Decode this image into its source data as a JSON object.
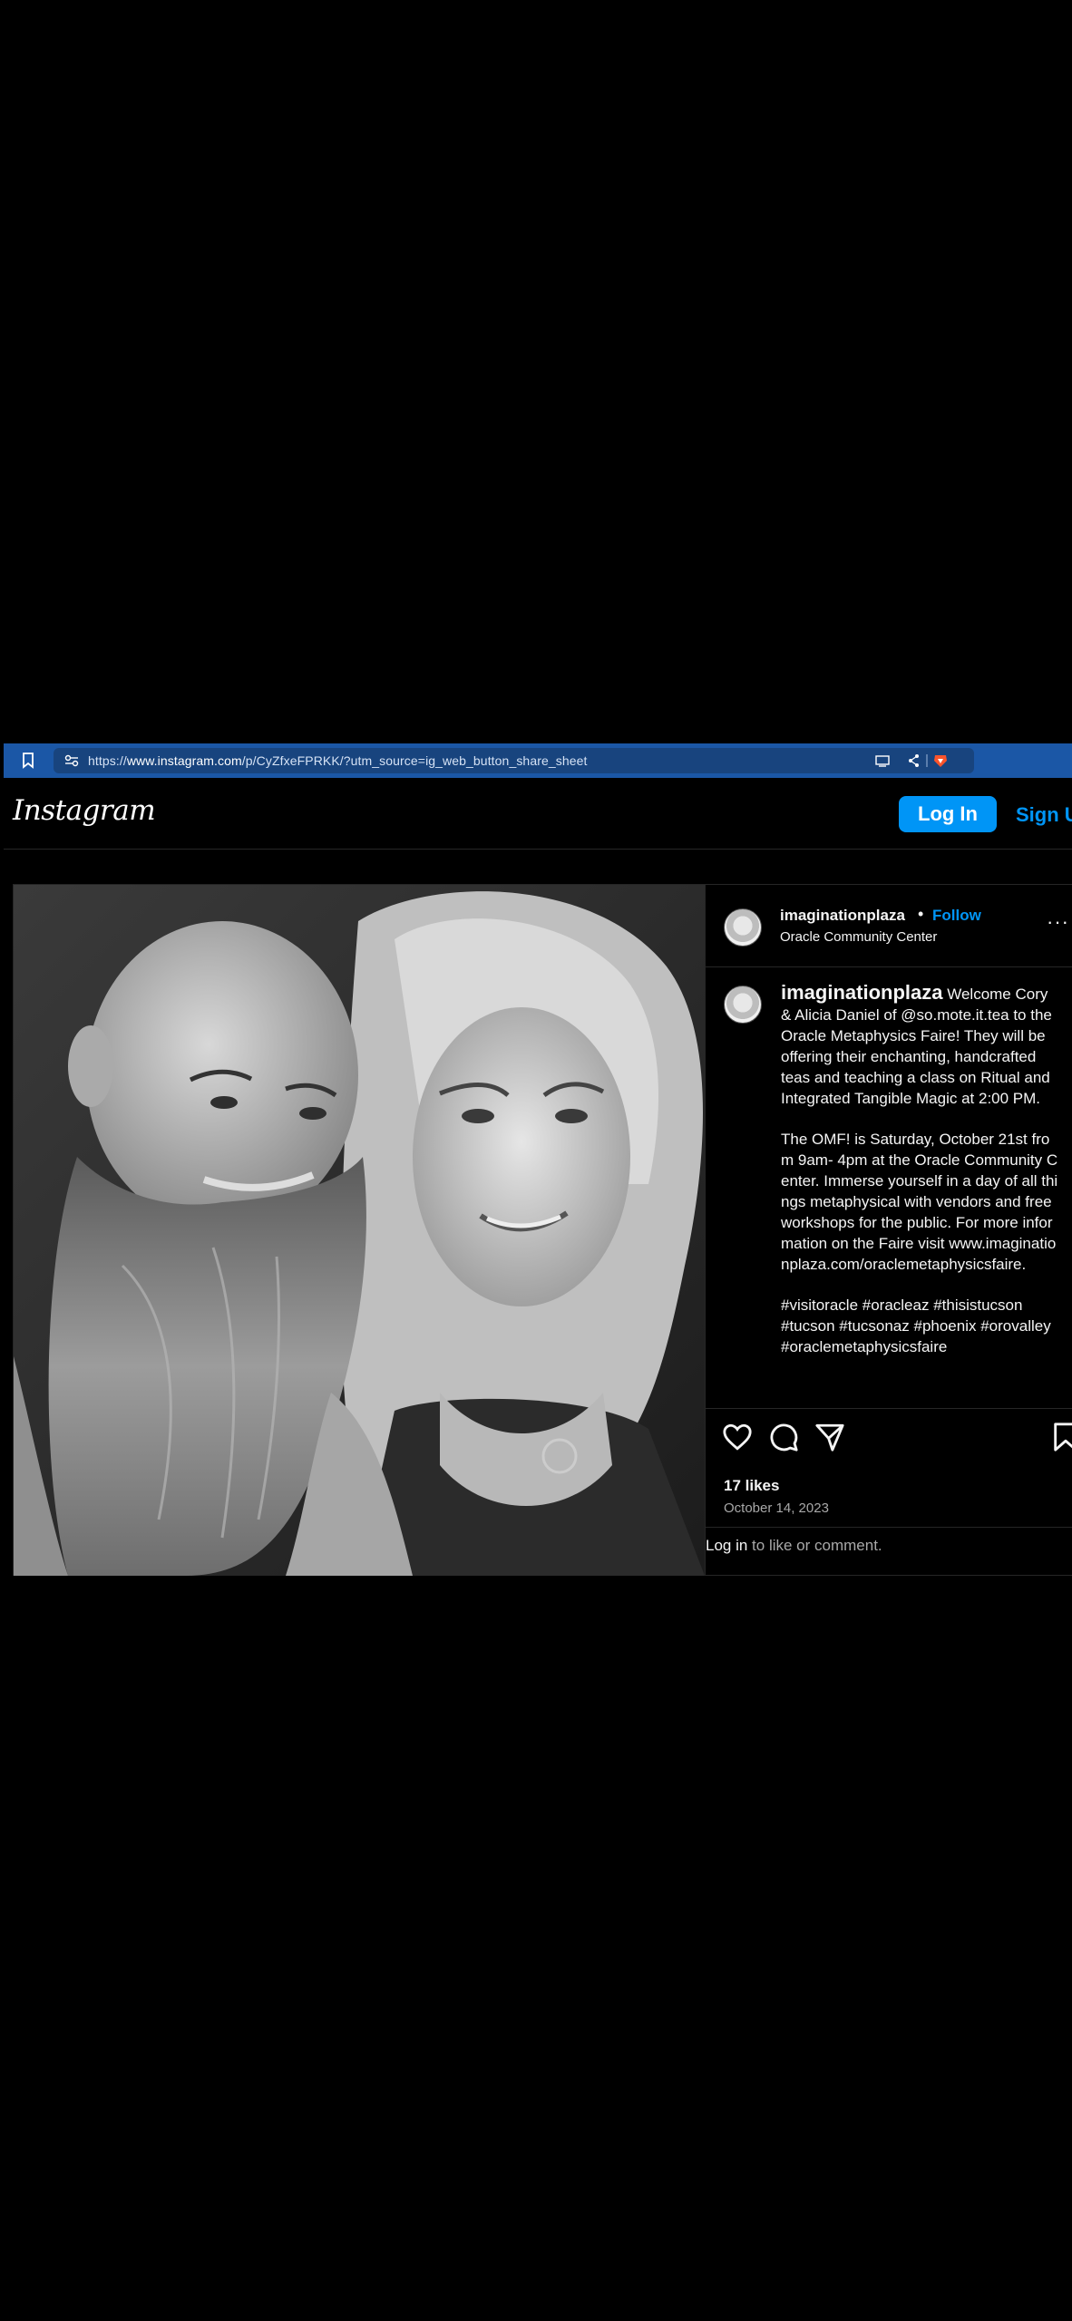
{
  "browser": {
    "url_prefix": "https://",
    "url_host": "www.instagram.com",
    "url_path": "/p/CyZfxeFPRKK/?utm_source=ig_web_button_share_sheet"
  },
  "header": {
    "logo": "Instagram",
    "login_label": "Log In",
    "signup_label": "Sign Up"
  },
  "post": {
    "username": "imaginationplaza",
    "separator": "•",
    "follow_label": "Follow",
    "location": "Oracle Community Center",
    "more_label": "···",
    "caption": {
      "username": "imaginationplaza",
      "paragraph1": "Welcome Cory & Alicia Daniel of @so.mote.it.tea to the Oracle Metaphysics Faire! They will be offering their enchanting, handcrafted teas and teaching a class on Ritual and Integrated Tangible Magic at 2:00 PM.",
      "paragraph2": "The OMF! is Saturday, October 21st from 9am- 4pm at the Oracle Community Center. Immerse yourself in a day of all things metaphysical with vendors and free workshops for the public. For more information on the Faire visit www.imaginationplaza.com/oraclemetaphysicsfaire.",
      "paragraph3": "#visitoracle #oracleaz #thisistucson #tucson #tucsonaz #phoenix #orovalley #oraclemetaphysicsfaire"
    },
    "likes": "17 likes",
    "date": "October 14, 2023",
    "login_link": "Log in",
    "login_prompt": " to like or comment."
  }
}
